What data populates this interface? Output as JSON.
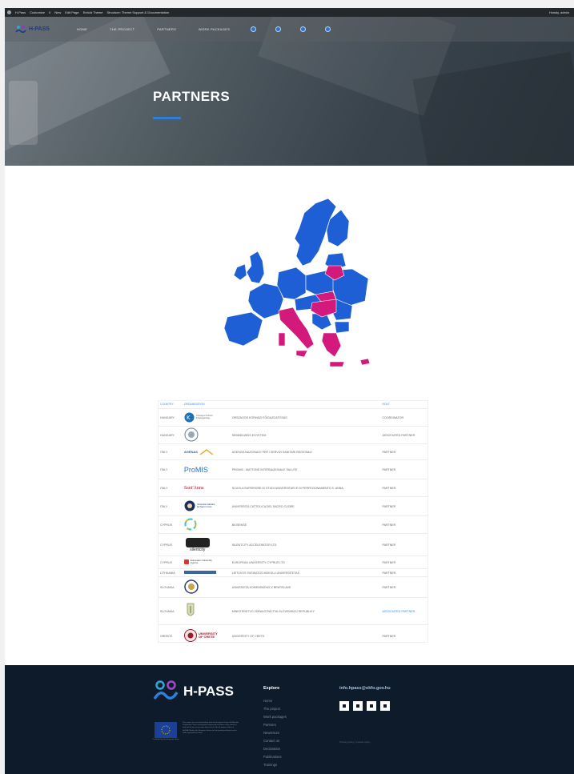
{
  "admin_bar": {
    "items": [
      "H-Pass",
      "Customize",
      "0",
      "New",
      "Edit Page",
      "Enfold Theme",
      "Structure: Theme Support & Documentation"
    ],
    "right": "Howdy, admin"
  },
  "header": {
    "logo_text": "H-PASS",
    "nav": [
      "HOME",
      "THE PROJECT",
      "PARTNERS",
      "WORK PACKAGES"
    ],
    "icons": [
      "youtube-icon",
      "twitter-icon",
      "linkedin-icon",
      "facebook-icon"
    ]
  },
  "hero": {
    "title": "PARTNERS"
  },
  "colors": {
    "map_blue": "#1f5fd6",
    "map_magenta": "#d4197c",
    "accent": "#2f7fd9",
    "footer_bg": "#0d1b2a"
  },
  "table": {
    "headers": [
      "COUNTRY",
      "ORGANISATION",
      "",
      "ROLE"
    ],
    "rows": [
      {
        "country": "HUNGARY",
        "logo": "Országos Kórházi Főigazgatóság",
        "org": "ORSZÁGOS KÓRHÁZI FŐIGAZGATÓSÁG",
        "role": "COORDINATOR"
      },
      {
        "country": "HUNGARY",
        "logo": "",
        "org": "SEMMELWEIS EGYETEM",
        "role": "ASSOCIATED PARTNER"
      },
      {
        "country": "ITALY",
        "logo": "AGENAS",
        "org": "AGENZIA NAZIONALE PER I SERVIZI SANITARI REGIONALI",
        "role": "PARTNER"
      },
      {
        "country": "ITALY",
        "logo": "ProMIS",
        "org": "PROMIS - MATTONE INTERNAZIONALE SALUTE",
        "role": "PARTNER"
      },
      {
        "country": "ITALY",
        "logo": "Sant'Anna",
        "org": "SCUOLA SUPERIORE DI STUDI UNIVERSITARI E DI PERFEZIONAMENTO S. ANNA",
        "role": "PARTNER"
      },
      {
        "country": "ITALY",
        "logo": "Università Cattolica del Sacro Cuore",
        "org": "UNIVERSITÀ CATTOLICA DEL SACRO CUORE",
        "role": "PARTNER"
      },
      {
        "country": "CYPRUS",
        "logo": "",
        "org": "BIOSENSE",
        "role": "PARTNER"
      },
      {
        "country": "CYPRUS",
        "logo": "silentcity",
        "org": "SILENTCITY ACCELERATOR LTD",
        "role": "PARTNER"
      },
      {
        "country": "CYPRUS",
        "logo": "European University Cyprus",
        "org": "EUROPEAN UNIVERSITY CYPRUS LTD",
        "role": "PARTNER"
      },
      {
        "country": "LITHUANIA",
        "logo": "",
        "org": "LIETUVOS SVEIKATOS MOKSLU UNIVERSITETAS",
        "role": "PARTNER"
      },
      {
        "country": "SLOVAKIA",
        "logo": "",
        "org": "UNIVERZITA KOMENSKÉHO V BRATISLAVE",
        "role": "PARTNER"
      },
      {
        "country": "SLOVAKIA",
        "logo": "",
        "org": "MINISTERSTVO ZDRAVOTNÍCTVA SLOVENSKEJ REPUBLIKY",
        "role": "ASSOCIATED PARTNER"
      },
      {
        "country": "GREECE",
        "logo": "UNIVERSITY OF CRETE",
        "org": "UNIVERSITY OF CRETE",
        "role": "PARTNER"
      }
    ]
  },
  "footer": {
    "logo_text": "H-PASS",
    "eu_caption": "Co-funded by the European Union",
    "eu_disclaimer": "This project has received funding from the European Union's EU4Health Programme. Views and opinions expressed are those of the author(s) only and do not necessarily reflect those of the European Union or HaDEA. Neither the European Union nor the granting authority can be held responsible for them.",
    "explore_title": "Explore",
    "explore_items": [
      "Home",
      "The project",
      "Work packages",
      "Partners",
      "Newsroom",
      "Contact us",
      "Declaration",
      "Publications",
      "Trainings"
    ],
    "email": "info.hpass@okfo.gov.hu",
    "social_icons": [
      "email-icon",
      "youtube-icon",
      "linkedin-icon",
      "twitter-icon"
    ],
    "small_text": "Privacy policy | Cookie policy"
  }
}
